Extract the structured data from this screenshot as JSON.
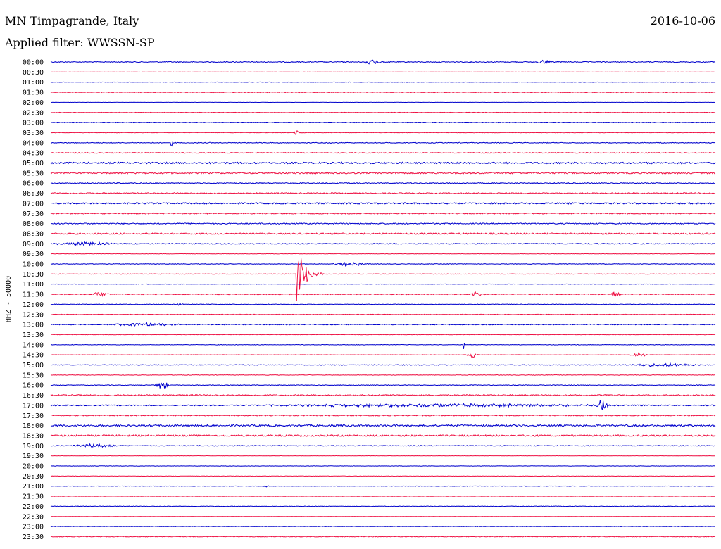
{
  "header": {
    "station": "MN Timpagrande, Italy",
    "filter": "Applied filter: WWSSN-SP",
    "date": "2016-10-06"
  },
  "chart_data": {
    "type": "line",
    "title": "MN Timpagrande, Italy",
    "subtitle": "Applied filter: WWSSN-SP",
    "ylabel": "HHZ - 50000",
    "grid": false,
    "colors": {
      "even_row": "#0000cc",
      "odd_row": "#ee1144"
    },
    "rows": [
      {
        "label": "00:00",
        "noise": 1.2,
        "events": [
          {
            "pos": 0.47,
            "amp": 3,
            "len": 0.03
          },
          {
            "pos": 0.73,
            "amp": 3,
            "len": 0.03
          }
        ]
      },
      {
        "label": "00:30",
        "noise": 0.3,
        "events": []
      },
      {
        "label": "01:00",
        "noise": 0.6,
        "events": []
      },
      {
        "label": "01:30",
        "noise": 1.0,
        "events": []
      },
      {
        "label": "02:00",
        "noise": 0.2,
        "events": []
      },
      {
        "label": "02:30",
        "noise": 0.7,
        "events": []
      },
      {
        "label": "03:00",
        "noise": 0.9,
        "events": []
      },
      {
        "label": "03:30",
        "noise": 0.6,
        "events": [
          {
            "pos": 0.365,
            "amp": 3,
            "len": 0.01
          }
        ]
      },
      {
        "label": "04:00",
        "noise": 1.0,
        "events": [
          {
            "pos": 0.18,
            "amp": 5,
            "len": 0.004
          }
        ]
      },
      {
        "label": "04:30",
        "noise": 1.2,
        "events": []
      },
      {
        "label": "05:00",
        "noise": 2.2,
        "events": []
      },
      {
        "label": "05:30",
        "noise": 2.0,
        "events": []
      },
      {
        "label": "06:00",
        "noise": 1.3,
        "events": []
      },
      {
        "label": "06:30",
        "noise": 1.6,
        "events": []
      },
      {
        "label": "07:00",
        "noise": 2.0,
        "events": []
      },
      {
        "label": "07:30",
        "noise": 1.5,
        "events": []
      },
      {
        "label": "08:00",
        "noise": 1.5,
        "events": []
      },
      {
        "label": "08:30",
        "noise": 2.0,
        "events": []
      },
      {
        "label": "09:00",
        "noise": 1.2,
        "events": [
          {
            "pos": 0.0,
            "amp": 2.5,
            "len": 0.1
          }
        ]
      },
      {
        "label": "09:30",
        "noise": 0.6,
        "events": []
      },
      {
        "label": "10:00",
        "noise": 0.8,
        "events": [
          {
            "pos": 0.42,
            "amp": 2.5,
            "len": 0.06
          }
        ]
      },
      {
        "label": "10:30",
        "noise": 0.8,
        "events": [
          {
            "pos": 0.37,
            "amp": 40,
            "len": 0.04
          }
        ]
      },
      {
        "label": "11:00",
        "noise": 0.6,
        "events": []
      },
      {
        "label": "11:30",
        "noise": 1.2,
        "events": [
          {
            "pos": 0.06,
            "amp": 3,
            "len": 0.03
          },
          {
            "pos": 0.63,
            "amp": 4,
            "len": 0.02
          },
          {
            "pos": 0.84,
            "amp": 4,
            "len": 0.02
          }
        ]
      },
      {
        "label": "12:00",
        "noise": 0.8,
        "events": [
          {
            "pos": 0.19,
            "amp": 3,
            "len": 0.01
          }
        ]
      },
      {
        "label": "12:30",
        "noise": 0.8,
        "events": []
      },
      {
        "label": "13:00",
        "noise": 1.2,
        "events": [
          {
            "pos": 0.08,
            "amp": 2,
            "len": 0.12
          }
        ]
      },
      {
        "label": "13:30",
        "noise": 0.6,
        "events": []
      },
      {
        "label": "14:00",
        "noise": 0.7,
        "events": [
          {
            "pos": 0.62,
            "amp": 10,
            "len": 0.003
          }
        ]
      },
      {
        "label": "14:30",
        "noise": 0.6,
        "events": [
          {
            "pos": 0.625,
            "amp": 4,
            "len": 0.02
          },
          {
            "pos": 0.87,
            "amp": 3,
            "len": 0.03
          }
        ]
      },
      {
        "label": "15:00",
        "noise": 1.0,
        "events": [
          {
            "pos": 0.85,
            "amp": 2,
            "len": 0.14
          }
        ]
      },
      {
        "label": "15:30",
        "noise": 0.7,
        "events": []
      },
      {
        "label": "16:00",
        "noise": 0.9,
        "events": [
          {
            "pos": 0.155,
            "amp": 5,
            "len": 0.025
          }
        ]
      },
      {
        "label": "16:30",
        "noise": 1.8,
        "events": []
      },
      {
        "label": "17:00",
        "noise": 1.5,
        "events": [
          {
            "pos": 0.28,
            "amp": 2,
            "len": 0.6
          },
          {
            "pos": 0.82,
            "amp": 8,
            "len": 0.02
          }
        ]
      },
      {
        "label": "17:30",
        "noise": 1.4,
        "events": []
      },
      {
        "label": "18:00",
        "noise": 2.3,
        "events": []
      },
      {
        "label": "18:30",
        "noise": 2.2,
        "events": []
      },
      {
        "label": "19:00",
        "noise": 1.0,
        "events": [
          {
            "pos": 0.03,
            "amp": 2.5,
            "len": 0.08
          }
        ]
      },
      {
        "label": "19:30",
        "noise": 0.3,
        "events": []
      },
      {
        "label": "20:00",
        "noise": 0.5,
        "events": []
      },
      {
        "label": "20:30",
        "noise": 0.6,
        "events": []
      },
      {
        "label": "21:00",
        "noise": 0.6,
        "events": [
          {
            "pos": 0.32,
            "amp": 2,
            "len": 0.01
          }
        ]
      },
      {
        "label": "21:30",
        "noise": 0.5,
        "events": []
      },
      {
        "label": "22:00",
        "noise": 0.8,
        "events": []
      },
      {
        "label": "22:30",
        "noise": 0.4,
        "events": []
      },
      {
        "label": "23:00",
        "noise": 0.6,
        "events": []
      },
      {
        "label": "23:30",
        "noise": 1.0,
        "events": []
      }
    ]
  }
}
